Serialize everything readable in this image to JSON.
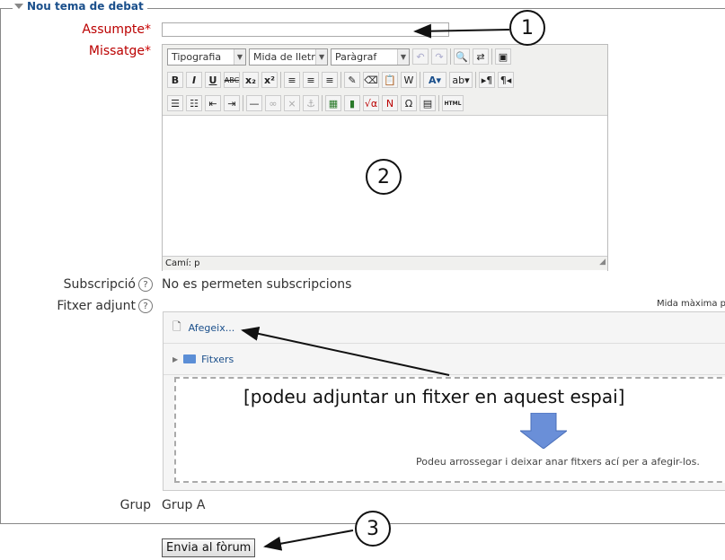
{
  "fieldset": {
    "legend": "Nou tema de debat"
  },
  "subject": {
    "label": "Assumpte",
    "required_mark": "*",
    "value": ""
  },
  "message": {
    "label": "Missatge",
    "required_mark": "*",
    "toolbar": {
      "font_family": "Tipografia",
      "font_size": "Mida de lletra",
      "format": "Paràgraf",
      "html_label": "HTML"
    },
    "status_path": "Camí: p"
  },
  "subscription": {
    "label": "Subscripció",
    "value": "No es permeten subscripcions"
  },
  "attachment": {
    "label": "Fitxer adjunt",
    "max_size_text": "Mida màxima pe",
    "add_link": "Afegeix...",
    "folder_label": "Fitxers",
    "drop_hint": "Podeu arrossegar i deixar anar fitxers ací per a afegir-los.",
    "annotation": "[podeu adjuntar un fitxer en aquest espai]"
  },
  "group": {
    "label": "Grup",
    "value": "Grup A"
  },
  "submit": {
    "label": "Envia al fòrum"
  },
  "callouts": [
    "1",
    "2",
    "3"
  ],
  "colors": {
    "legend": "#1a4f8b",
    "required_label": "#bb0000",
    "link": "#1a4f8b",
    "arrow_fill": "#6a8fd8"
  }
}
